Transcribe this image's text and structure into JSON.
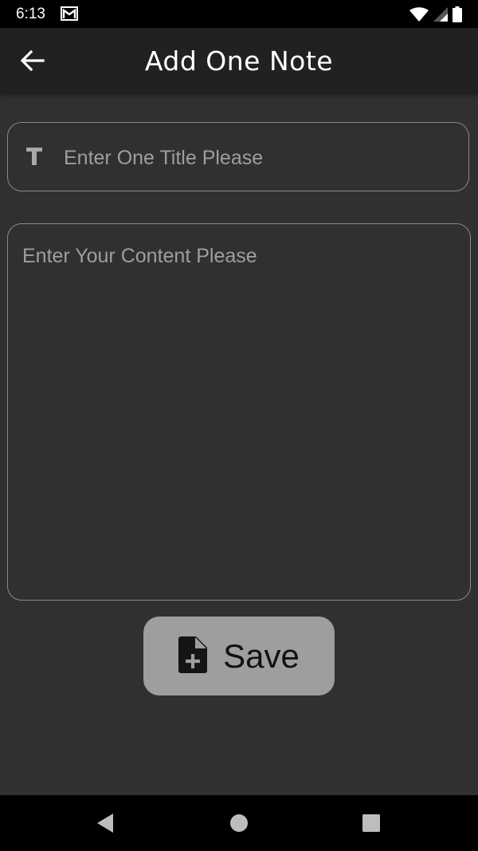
{
  "status_bar": {
    "time": "6:13",
    "icons": [
      "gmail-icon",
      "wifi-icon",
      "cellular-signal-icon",
      "battery-icon"
    ]
  },
  "app_bar": {
    "title": "Add One Note",
    "back_icon": "arrow-left-icon"
  },
  "form": {
    "title_placeholder": "Enter One Title Please",
    "title_value": "",
    "title_icon": "text-T-icon",
    "content_placeholder": "Enter Your Content Please",
    "content_value": ""
  },
  "save_button": {
    "label": "Save",
    "icon": "file-add-icon"
  },
  "nav_bar": {
    "buttons": [
      "back-triangle-icon",
      "home-circle-icon",
      "recents-square-icon"
    ]
  },
  "colors": {
    "background": "#303030",
    "app_bar": "#212121",
    "save_button": "#9e9e9e",
    "field_border": "#8a8a8a",
    "placeholder": "#9e9e9e"
  }
}
